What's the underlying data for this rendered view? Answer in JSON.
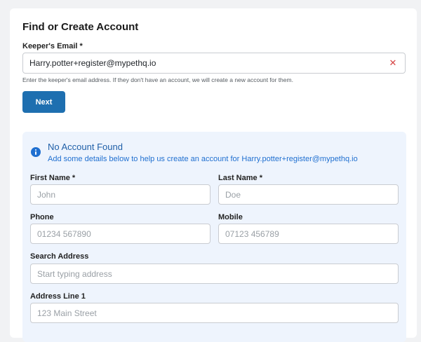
{
  "form": {
    "title": "Find or Create Account",
    "email_label": "Keeper's Email *",
    "email_value": "Harry.potter+register@mypethq.io",
    "email_help": "Enter the keeper's email address. If they don't have an account, we will create a new account for them.",
    "next_label": "Next"
  },
  "notice": {
    "title": "No Account Found",
    "message": "Add some details below to help us create an account for Harry.potter+register@mypethq.io"
  },
  "fields": {
    "first_name_label": "First Name *",
    "first_name_placeholder": "John",
    "last_name_label": "Last Name *",
    "last_name_placeholder": "Doe",
    "phone_label": "Phone",
    "phone_placeholder": "01234 567890",
    "mobile_label": "Mobile",
    "mobile_placeholder": "07123 456789",
    "search_address_label": "Search Address",
    "search_address_placeholder": "Start typing address",
    "address_line1_label": "Address Line 1",
    "address_line1_placeholder": "123 Main Street"
  },
  "colors": {
    "primary_button": "#1e6fb0",
    "notice_background": "#eef4fd",
    "notice_text": "#1f6fd0",
    "clear_icon": "#d64545"
  }
}
